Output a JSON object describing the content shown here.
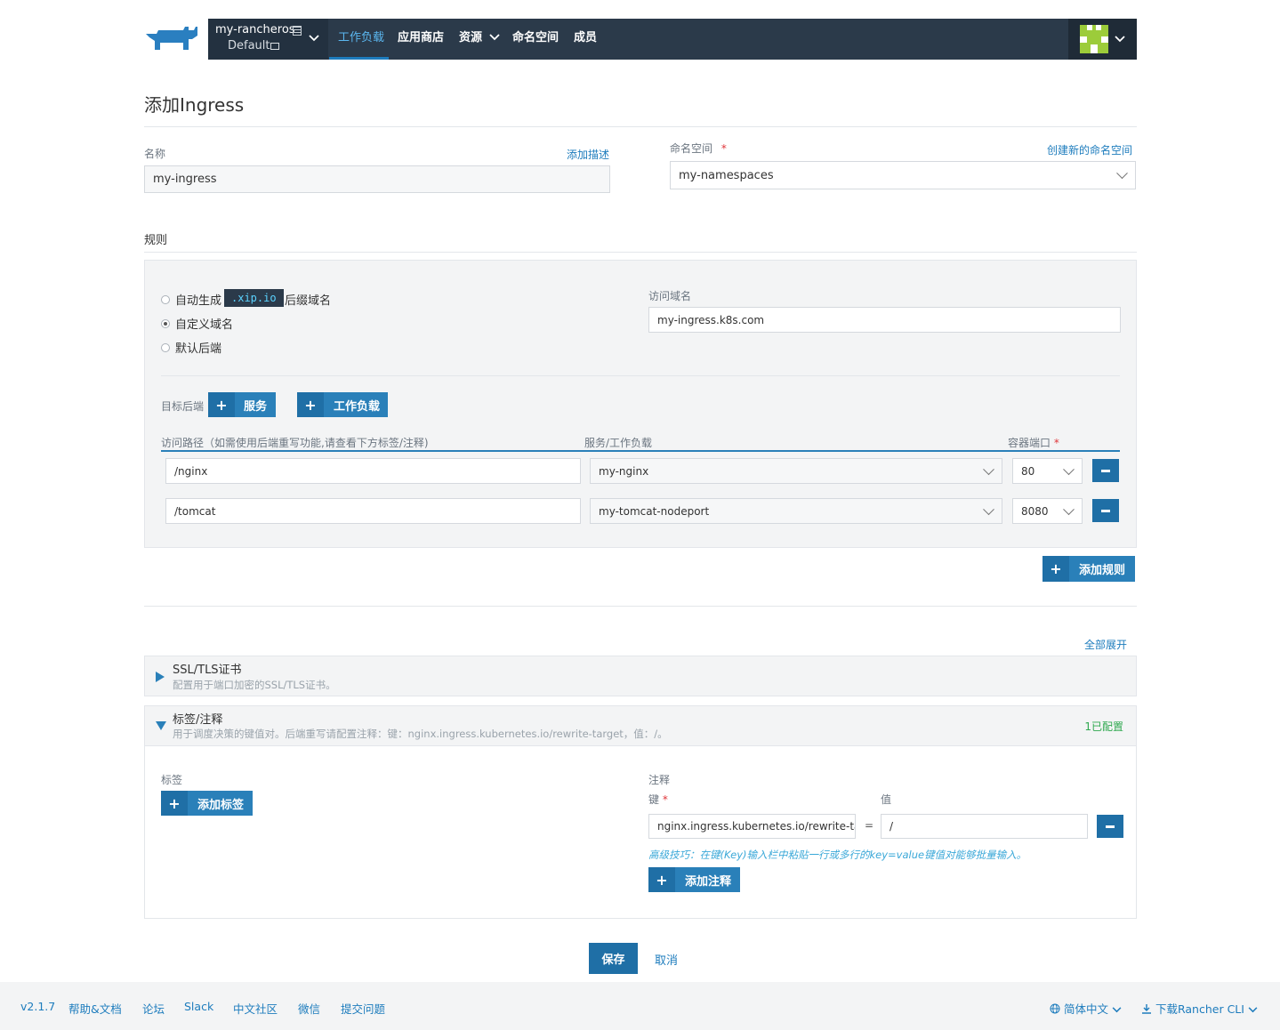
{
  "header": {
    "cluster_name": "my-rancheros",
    "project_name": "Default",
    "nav": [
      {
        "label": "工作负载"
      },
      {
        "label": "应用商店"
      },
      {
        "label": "资源"
      },
      {
        "label": "命名空间"
      },
      {
        "label": "成员"
      }
    ]
  },
  "page": {
    "title": "添加Ingress"
  },
  "form": {
    "name_label": "名称",
    "add_desc_link": "添加描述",
    "name_value": "my-ingress",
    "ns_label": "命名空间",
    "ns_required": "*",
    "create_ns_link": "创建新的命名空间",
    "ns_value": "my-namespaces"
  },
  "rules": {
    "section_title": "规则",
    "radio_auto_prefix": "自动生成",
    "radio_auto_badge": ".xip.io",
    "radio_auto_suffix": "后缀域名",
    "radio_custom": "自定义域名",
    "radio_default": "默认后端",
    "selected_option": "自定义域名",
    "host_label": "访问域名",
    "host_value": "my-ingress.k8s.com",
    "target_label": "目标后端",
    "btn_service": "服务",
    "btn_workload": "工作负载",
    "col_path": "访问路径（如需使用后端重写功能,请查看下方标签/注释)",
    "col_target": "服务/工作负载",
    "col_port": "容器端口",
    "col_port_req": "*",
    "rows": [
      {
        "path": "/nginx",
        "target": "my-nginx",
        "port": "80"
      },
      {
        "path": "/tomcat",
        "target": "my-tomcat-nodeport",
        "port": "8080"
      }
    ],
    "add_rule": "添加规则"
  },
  "expand_all": "全部展开",
  "ssl": {
    "title": "SSL/TLS证书",
    "subtitle": "配置用于端口加密的SSL/TLS证书。"
  },
  "labels": {
    "title": "标签/注释",
    "subtitle": "用于调度决策的键值对。后端重写请配置注释：键：nginx.ingress.kubernetes.io/rewrite-target，值：/。",
    "status": "1已配置",
    "labels_label": "标签",
    "add_label": "添加标签",
    "annotations_label": "注释",
    "key_label": "键",
    "key_req": "*",
    "value_label": "值",
    "key_value": "nginx.ingress.kubernetes.io/rewrite-target",
    "eq": "=",
    "val_value": "/",
    "tip": "高级技巧：在键(Key)输入栏中粘贴一行或多行的key=value键值对能够批量输入。",
    "add_annotation": "添加注释"
  },
  "actions": {
    "save": "保存",
    "cancel": "取消"
  },
  "footer": {
    "version": "v2.1.7",
    "links": [
      "帮助&文档",
      "论坛",
      "Slack",
      "中文社区",
      "微信",
      "提交问题"
    ],
    "language": "简体中文",
    "download": "下载Rancher CLI"
  },
  "colors": {
    "nav_bg": "#2b3a4a",
    "accent": "#2a80b9",
    "link": "#1d7cbd",
    "success": "#2fa84f"
  }
}
